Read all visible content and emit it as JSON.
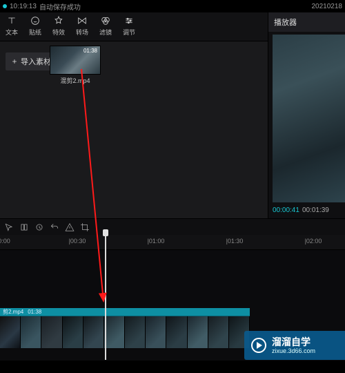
{
  "titlebar": {
    "time": "10:19:13",
    "status": "自动保存成功",
    "date": "20210218"
  },
  "toolbar": {
    "text": {
      "label": "文本"
    },
    "sticker": {
      "label": "贴纸"
    },
    "effect": {
      "label": "特效"
    },
    "transition": {
      "label": "转场"
    },
    "filter": {
      "label": "滤镜"
    },
    "adjust": {
      "label": "调节"
    }
  },
  "media": {
    "import_label": "导入素材",
    "clip": {
      "name": "混剪2.mp4",
      "duration": "01:38"
    }
  },
  "preview": {
    "title": "播放器",
    "current": "00:00:41",
    "total": "00:01:39"
  },
  "ruler": {
    "t0": "0:00",
    "t1": "|00:30",
    "t2": "|01:00",
    "t3": "|01:30",
    "t4": "|02:00"
  },
  "track_clip": {
    "name": "剪2.mp4",
    "duration": "01:38"
  },
  "watermark": {
    "brand": "溜溜自学",
    "domain": "zixue.3d66.com"
  }
}
